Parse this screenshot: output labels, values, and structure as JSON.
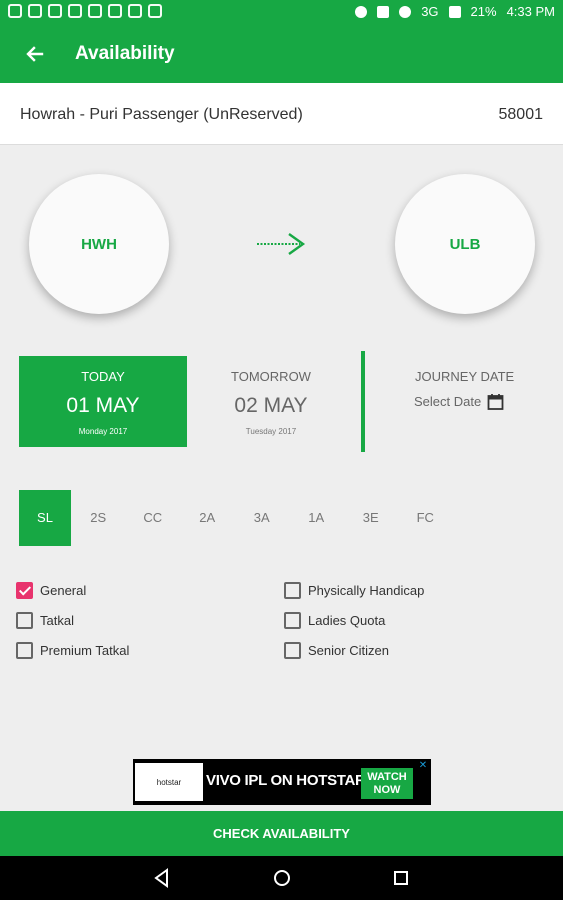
{
  "status_bar": {
    "network": "3G",
    "battery": "21%",
    "time": "4:33 PM"
  },
  "app_bar": {
    "title": "Availability",
    "back_icon": "arrow-left-icon"
  },
  "train": {
    "name": "Howrah - Puri Passenger (UnReserved)",
    "number": "58001"
  },
  "route": {
    "from": "HWH",
    "to": "ULB",
    "arrow_icon": "arrow-right-icon"
  },
  "dates": {
    "today": {
      "label": "TODAY",
      "date": "01 MAY",
      "sub": "Monday 2017"
    },
    "tomorrow": {
      "label": "TOMORROW",
      "date": "02 MAY",
      "sub": "Tuesday 2017"
    },
    "journey": {
      "label": "JOURNEY DATE",
      "select": "Select Date",
      "icon": "calendar-icon"
    }
  },
  "classes": {
    "items": [
      "SL",
      "2S",
      "CC",
      "2A",
      "3A",
      "1A",
      "3E",
      "FC"
    ],
    "selected": "SL"
  },
  "quotas": {
    "general": {
      "label": "General",
      "checked": true
    },
    "tatkal": {
      "label": "Tatkal",
      "checked": false
    },
    "premium_tatkal": {
      "label": "Premium Tatkal",
      "checked": false
    },
    "physically_handicap": {
      "label": "Physically Handicap",
      "checked": false
    },
    "ladies_quota": {
      "label": "Ladies Quota",
      "checked": false
    },
    "senior_citizen": {
      "label": "Senior Citizen",
      "checked": false
    }
  },
  "ad": {
    "logo_text": "hotstar",
    "text": "VIVO IPL ON HOTSTAR",
    "cta": "WATCH NOW",
    "close": "✕"
  },
  "actions": {
    "check_availability": "CHECK AVAILABILITY"
  },
  "colors": {
    "primary": "#17a844",
    "checkbox_accent": "#e8336d",
    "background": "#eeeeee"
  }
}
